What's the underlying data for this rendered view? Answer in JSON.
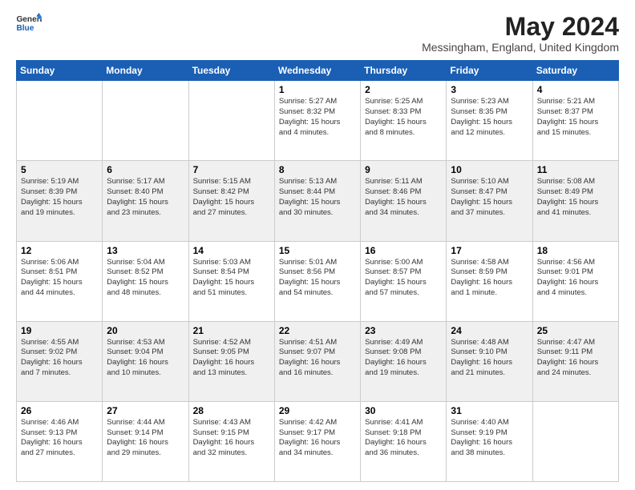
{
  "logo": {
    "general": "General",
    "blue": "Blue"
  },
  "title": "May 2024",
  "location": "Messingham, England, United Kingdom",
  "days_of_week": [
    "Sunday",
    "Monday",
    "Tuesday",
    "Wednesday",
    "Thursday",
    "Friday",
    "Saturday"
  ],
  "weeks": [
    [
      {
        "num": "",
        "info": ""
      },
      {
        "num": "",
        "info": ""
      },
      {
        "num": "",
        "info": ""
      },
      {
        "num": "1",
        "info": "Sunrise: 5:27 AM\nSunset: 8:32 PM\nDaylight: 15 hours\nand 4 minutes."
      },
      {
        "num": "2",
        "info": "Sunrise: 5:25 AM\nSunset: 8:33 PM\nDaylight: 15 hours\nand 8 minutes."
      },
      {
        "num": "3",
        "info": "Sunrise: 5:23 AM\nSunset: 8:35 PM\nDaylight: 15 hours\nand 12 minutes."
      },
      {
        "num": "4",
        "info": "Sunrise: 5:21 AM\nSunset: 8:37 PM\nDaylight: 15 hours\nand 15 minutes."
      }
    ],
    [
      {
        "num": "5",
        "info": "Sunrise: 5:19 AM\nSunset: 8:39 PM\nDaylight: 15 hours\nand 19 minutes."
      },
      {
        "num": "6",
        "info": "Sunrise: 5:17 AM\nSunset: 8:40 PM\nDaylight: 15 hours\nand 23 minutes."
      },
      {
        "num": "7",
        "info": "Sunrise: 5:15 AM\nSunset: 8:42 PM\nDaylight: 15 hours\nand 27 minutes."
      },
      {
        "num": "8",
        "info": "Sunrise: 5:13 AM\nSunset: 8:44 PM\nDaylight: 15 hours\nand 30 minutes."
      },
      {
        "num": "9",
        "info": "Sunrise: 5:11 AM\nSunset: 8:46 PM\nDaylight: 15 hours\nand 34 minutes."
      },
      {
        "num": "10",
        "info": "Sunrise: 5:10 AM\nSunset: 8:47 PM\nDaylight: 15 hours\nand 37 minutes."
      },
      {
        "num": "11",
        "info": "Sunrise: 5:08 AM\nSunset: 8:49 PM\nDaylight: 15 hours\nand 41 minutes."
      }
    ],
    [
      {
        "num": "12",
        "info": "Sunrise: 5:06 AM\nSunset: 8:51 PM\nDaylight: 15 hours\nand 44 minutes."
      },
      {
        "num": "13",
        "info": "Sunrise: 5:04 AM\nSunset: 8:52 PM\nDaylight: 15 hours\nand 48 minutes."
      },
      {
        "num": "14",
        "info": "Sunrise: 5:03 AM\nSunset: 8:54 PM\nDaylight: 15 hours\nand 51 minutes."
      },
      {
        "num": "15",
        "info": "Sunrise: 5:01 AM\nSunset: 8:56 PM\nDaylight: 15 hours\nand 54 minutes."
      },
      {
        "num": "16",
        "info": "Sunrise: 5:00 AM\nSunset: 8:57 PM\nDaylight: 15 hours\nand 57 minutes."
      },
      {
        "num": "17",
        "info": "Sunrise: 4:58 AM\nSunset: 8:59 PM\nDaylight: 16 hours\nand 1 minute."
      },
      {
        "num": "18",
        "info": "Sunrise: 4:56 AM\nSunset: 9:01 PM\nDaylight: 16 hours\nand 4 minutes."
      }
    ],
    [
      {
        "num": "19",
        "info": "Sunrise: 4:55 AM\nSunset: 9:02 PM\nDaylight: 16 hours\nand 7 minutes."
      },
      {
        "num": "20",
        "info": "Sunrise: 4:53 AM\nSunset: 9:04 PM\nDaylight: 16 hours\nand 10 minutes."
      },
      {
        "num": "21",
        "info": "Sunrise: 4:52 AM\nSunset: 9:05 PM\nDaylight: 16 hours\nand 13 minutes."
      },
      {
        "num": "22",
        "info": "Sunrise: 4:51 AM\nSunset: 9:07 PM\nDaylight: 16 hours\nand 16 minutes."
      },
      {
        "num": "23",
        "info": "Sunrise: 4:49 AM\nSunset: 9:08 PM\nDaylight: 16 hours\nand 19 minutes."
      },
      {
        "num": "24",
        "info": "Sunrise: 4:48 AM\nSunset: 9:10 PM\nDaylight: 16 hours\nand 21 minutes."
      },
      {
        "num": "25",
        "info": "Sunrise: 4:47 AM\nSunset: 9:11 PM\nDaylight: 16 hours\nand 24 minutes."
      }
    ],
    [
      {
        "num": "26",
        "info": "Sunrise: 4:46 AM\nSunset: 9:13 PM\nDaylight: 16 hours\nand 27 minutes."
      },
      {
        "num": "27",
        "info": "Sunrise: 4:44 AM\nSunset: 9:14 PM\nDaylight: 16 hours\nand 29 minutes."
      },
      {
        "num": "28",
        "info": "Sunrise: 4:43 AM\nSunset: 9:15 PM\nDaylight: 16 hours\nand 32 minutes."
      },
      {
        "num": "29",
        "info": "Sunrise: 4:42 AM\nSunset: 9:17 PM\nDaylight: 16 hours\nand 34 minutes."
      },
      {
        "num": "30",
        "info": "Sunrise: 4:41 AM\nSunset: 9:18 PM\nDaylight: 16 hours\nand 36 minutes."
      },
      {
        "num": "31",
        "info": "Sunrise: 4:40 AM\nSunset: 9:19 PM\nDaylight: 16 hours\nand 38 minutes."
      },
      {
        "num": "",
        "info": ""
      }
    ]
  ]
}
